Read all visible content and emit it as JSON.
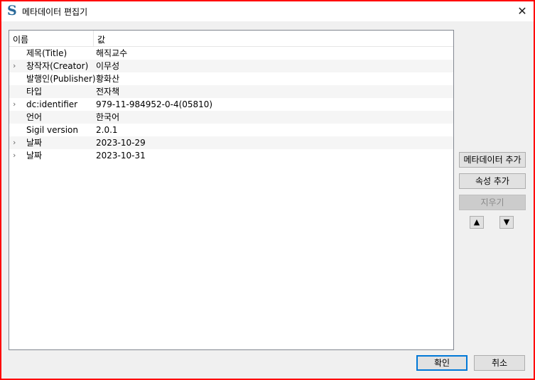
{
  "window": {
    "title": "메타데이터 편집기",
    "app_icon_glyph": "S",
    "close_glyph": "✕",
    "frame_color": "#ff0000"
  },
  "tree": {
    "columns": [
      "이름",
      "값"
    ],
    "rows": [
      {
        "expandable": false,
        "name": "제목(Title)",
        "value": "해직교수"
      },
      {
        "expandable": true,
        "name": "창작자(Creator)",
        "value": "이무성"
      },
      {
        "expandable": false,
        "name": "발행인(Publisher)",
        "value": "황화산"
      },
      {
        "expandable": false,
        "name": "타입",
        "value": "전자책"
      },
      {
        "expandable": true,
        "name": "dc:identifier",
        "value": "979-11-984952-0-4(05810)"
      },
      {
        "expandable": false,
        "name": "언어",
        "value": "한국어"
      },
      {
        "expandable": false,
        "name": "Sigil version",
        "value": "2.0.1"
      },
      {
        "expandable": true,
        "name": "날짜",
        "value": "2023-10-29"
      },
      {
        "expandable": true,
        "name": "날짜",
        "value": "2023-10-31"
      }
    ],
    "chevron_glyph": "›"
  },
  "side_buttons": {
    "add_metadata": "메타데이터 추가",
    "add_property": "속성 추가",
    "remove": "지우기",
    "move_up_glyph": "▲",
    "move_down_glyph": "▼"
  },
  "footer": {
    "ok": "확인",
    "cancel": "취소"
  }
}
